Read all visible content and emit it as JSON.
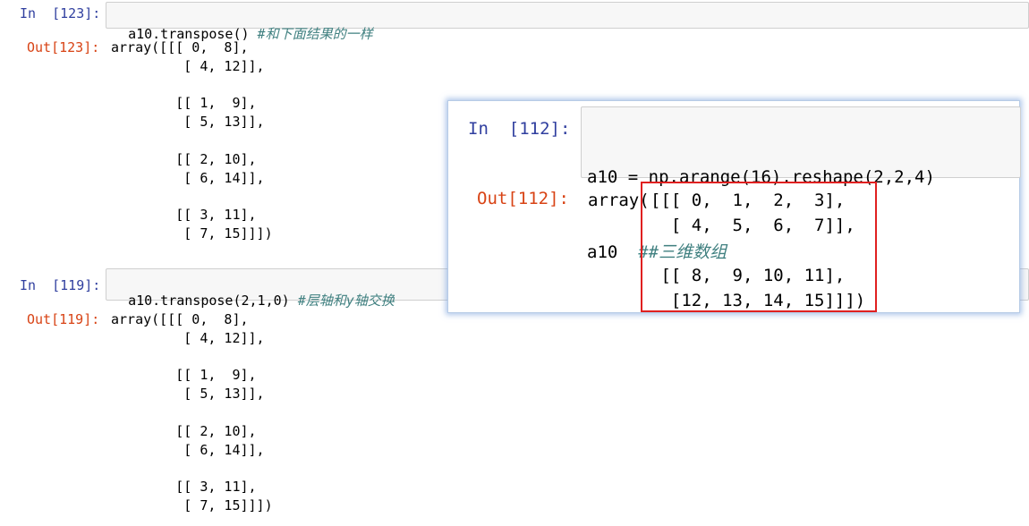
{
  "cells": [
    {
      "in_prompt": "In  [123]:",
      "code_fn": "a10.transpose()",
      "code_comment": " #和下面结果的一样",
      "out_prompt": "Out[123]:",
      "output": "array([[[ 0,  8],\n         [ 4, 12]],\n\n        [[ 1,  9],\n         [ 5, 13]],\n\n        [[ 2, 10],\n         [ 6, 14]],\n\n        [[ 3, 11],\n         [ 7, 15]]])"
    },
    {
      "in_prompt": "In  [119]:",
      "code_fn": "a10.transpose(2,1,0)",
      "code_comment": " #层轴和y轴交换",
      "out_prompt": "Out[119]:",
      "output": "array([[[ 0,  8],\n         [ 4, 12]],\n\n        [[ 1,  9],\n         [ 5, 13]],\n\n        [[ 2, 10],\n         [ 6, 14]],\n\n        [[ 3, 11],\n         [ 7, 15]]])"
    }
  ],
  "popup": {
    "in_prompt": "In  [112]:",
    "code_line1": "a10 = np.arange(16).reshape(2,2,4)",
    "code_line2_var": "a10",
    "code_line2_comment": "  ##三维数组",
    "out_prompt": "Out[112]:",
    "output_prefix": "array(",
    "output_body": "[[[ 0,  1,  2,  3],\n  [ 4,  5,  6,  7]],\n\n [[ 8,  9, 10, 11],\n  [12, 13, 14, 15]]])"
  },
  "colors": {
    "in_prompt": "#303f9f",
    "out_prompt": "#d84315",
    "highlight": "#e02020"
  }
}
